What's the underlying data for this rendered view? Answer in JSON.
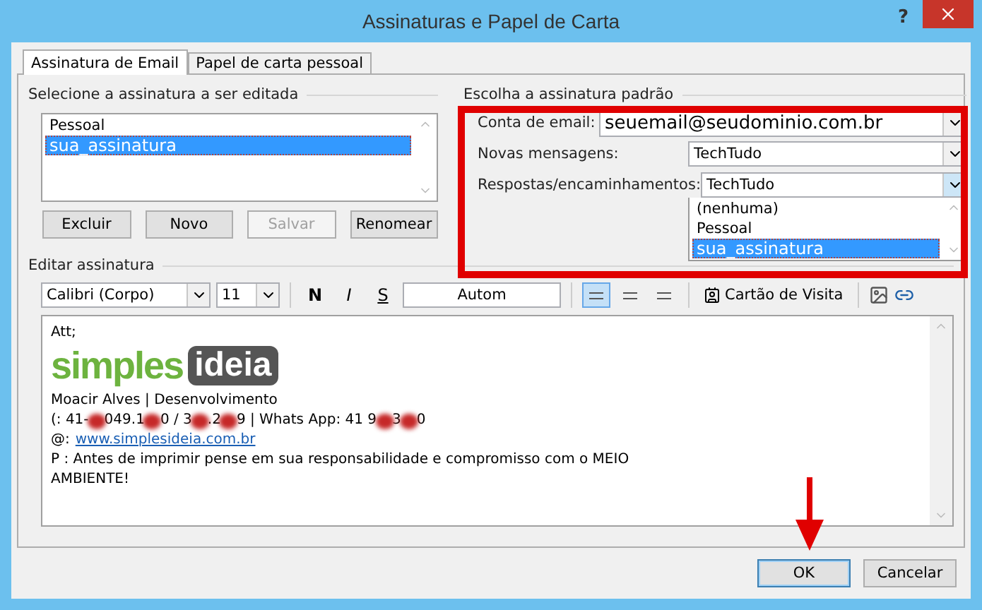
{
  "window": {
    "title": "Assinaturas e Papel de Carta",
    "help": "?"
  },
  "tabs": [
    {
      "label": "Assinatura de Email",
      "selected": true
    },
    {
      "label": "Papel de carta pessoal",
      "selected": false
    }
  ],
  "edit_section": {
    "title": "Selecione a assinatura a ser editada",
    "signatures": [
      {
        "label": "Pessoal",
        "selected": false
      },
      {
        "label": "sua_assinatura",
        "selected": true
      }
    ],
    "buttons": [
      {
        "label": "Excluir",
        "disabled": false
      },
      {
        "label": "Novo",
        "disabled": false
      },
      {
        "label": "Salvar",
        "disabled": true
      },
      {
        "label": "Renomear",
        "disabled": false
      }
    ]
  },
  "default_section": {
    "title": "Escolha a assinatura padrão",
    "account": {
      "label": "Conta de email:",
      "value": "seuemail@seudominio.com.br"
    },
    "new_messages": {
      "label": "Novas mensagens:",
      "value": "TechTudo"
    },
    "replies": {
      "label": "Respostas/encaminhamentos:",
      "value": "TechTudo",
      "expanded": true,
      "options": [
        {
          "label": "(nenhuma)",
          "selected": false
        },
        {
          "label": "Pessoal",
          "selected": false
        },
        {
          "label": "sua_assinatura",
          "selected": true
        }
      ]
    }
  },
  "editor": {
    "title": "Editar assinatura",
    "font": "Calibri (Corpo)",
    "size": "11",
    "format_buttons": [
      {
        "label": "N",
        "kind": "bold"
      },
      {
        "label": "I",
        "kind": "italic"
      },
      {
        "label": "S",
        "kind": "underline"
      }
    ],
    "color_label": "Autom",
    "alignments": [
      {
        "selected": true
      },
      {
        "selected": false
      },
      {
        "selected": false
      }
    ],
    "business_card": "Cartão de Visita",
    "greeting": "Att;",
    "logo": {
      "left": "simples",
      "right": "ideia"
    },
    "lines": [
      {
        "kind": "text",
        "text": "Moacir Alves | Desenvolvimento"
      },
      {
        "kind": "phone",
        "parts": [
          {
            "text": "(: 41-",
            "redacted": false
          },
          {
            "redacted": true
          },
          {
            "text": "049.1",
            "redacted": false
          },
          {
            "redacted": true
          },
          {
            "text": "0 / 3",
            "redacted": false
          },
          {
            "redacted": true
          },
          {
            "text": ".2",
            "redacted": false
          },
          {
            "redacted": true
          },
          {
            "text": "9 | Whats App: 41 9",
            "redacted": false
          },
          {
            "redacted": true
          },
          {
            "text": "3",
            "redacted": false
          },
          {
            "redacted": true
          },
          {
            "text": "0",
            "redacted": false
          }
        ]
      },
      {
        "kind": "link",
        "label": "@:",
        "text": "www.simplesideia.com.br"
      },
      {
        "kind": "text",
        "text": "P : Antes de imprimir pense em sua responsabilidade e compromisso com o MEIO"
      },
      {
        "kind": "text",
        "text": "AMBIENTE!"
      }
    ]
  },
  "footer_buttons": [
    {
      "label": "OK",
      "default": true
    },
    {
      "label": "Cancelar",
      "default": false
    }
  ]
}
